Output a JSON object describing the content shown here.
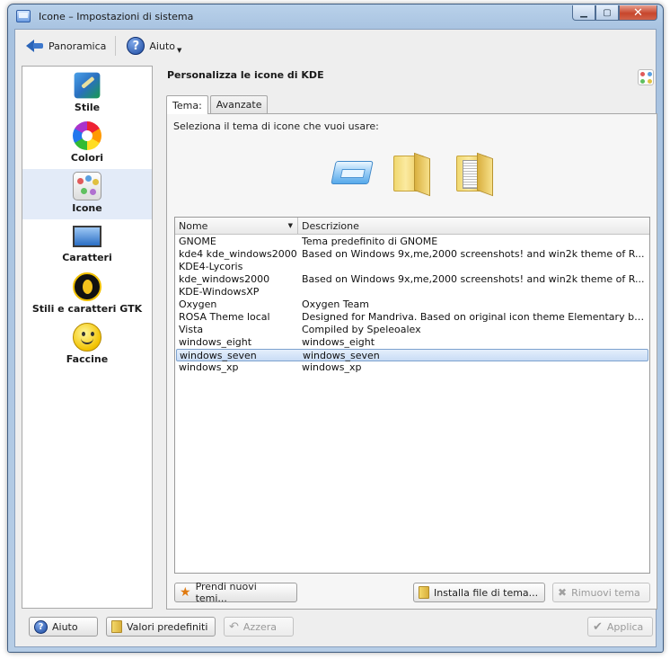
{
  "window": {
    "title": "Icone – Impostazioni di sistema",
    "minimize_label": "▁",
    "maximize_label": "▢",
    "close_label": "✕"
  },
  "toolbar": {
    "overview_label": "Panoramica",
    "help_label": "Aiuto"
  },
  "sidebar": {
    "items": [
      {
        "label": "Stile",
        "icon": "style-brush-icon"
      },
      {
        "label": "Colori",
        "icon": "color-palette-icon"
      },
      {
        "label": "Icone",
        "icon": "icons-theme-icon",
        "selected": true
      },
      {
        "label": "Caratteri",
        "icon": "fonts-monitor-icon"
      },
      {
        "label": "Stili e caratteri GTK",
        "icon": "gtk-logo-icon"
      },
      {
        "label": "Faccine",
        "icon": "smiley-icon"
      }
    ]
  },
  "main": {
    "heading": "Personalizza le icone di KDE",
    "tabs": [
      {
        "label": "Tema:",
        "active": true
      },
      {
        "label": "Avanzate",
        "active": false
      }
    ],
    "select_label": "Seleziona il tema di icone che vuoi usare:",
    "preview_icons": [
      "drive-icon",
      "folder-icon",
      "folder-documents-icon"
    ],
    "list": {
      "columns": [
        "Nome",
        "Descrizione"
      ],
      "rows": [
        {
          "name": "GNOME",
          "desc": "Tema predefinito di GNOME"
        },
        {
          "name": "kde4 kde_windows2000",
          "desc": " Based on Windows 9x,me,2000 screenshots! and win2k theme of R..."
        },
        {
          "name": "KDE4-Lycoris",
          "desc": ""
        },
        {
          "name": " kde_windows2000",
          "desc": " Based on Windows 9x,me,2000 screenshots! and win2k theme of R..."
        },
        {
          "name": "KDE-WindowsXP",
          "desc": ""
        },
        {
          "name": "Oxygen",
          "desc": "Oxygen Team"
        },
        {
          "name": "ROSA Theme local",
          "desc": "Designed for Mandriva. Based on original icon theme Elementary by ..."
        },
        {
          "name": "Vista",
          "desc": "Compiled by Speleoalex"
        },
        {
          "name": "windows_eight",
          "desc": "windows_eight"
        },
        {
          "name": "windows_seven",
          "desc": "windows_seven",
          "selected": true
        },
        {
          "name": "windows_xp",
          "desc": "windows_xp"
        }
      ]
    },
    "buttons": {
      "get_new": "Prendi nuovi temi...",
      "install": "Installa file di tema...",
      "remove": "Rimuovi tema"
    }
  },
  "footer": {
    "help": "Aiuto",
    "defaults": "Valori predefiniti",
    "reset": "Azzera",
    "apply": "Applica"
  }
}
